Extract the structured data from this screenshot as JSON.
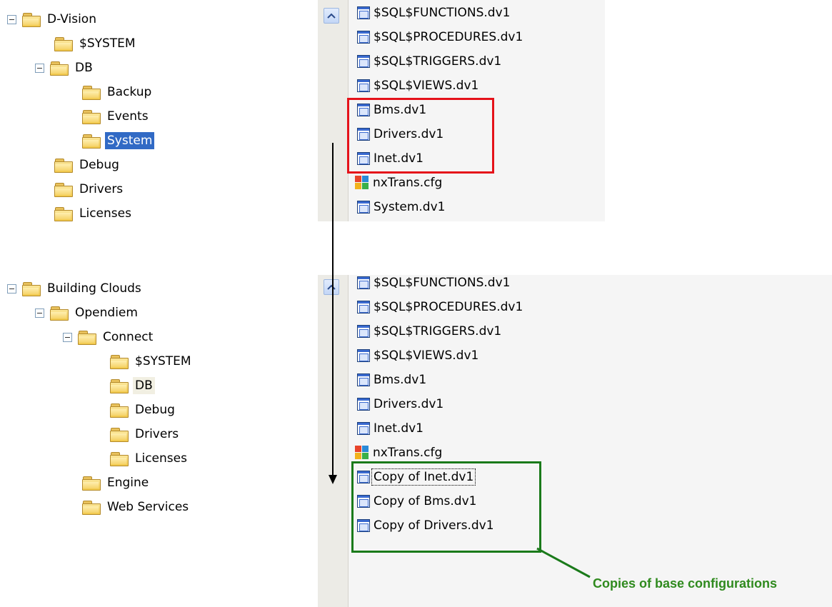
{
  "tree_top": {
    "root": "D-Vision",
    "children": [
      "$SYSTEM",
      "DB",
      "Backup",
      "Events",
      "System",
      "Debug",
      "Drivers",
      "Licenses"
    ]
  },
  "tree_bottom": {
    "root": "Building Clouds",
    "items": [
      "Opendiem",
      "Connect",
      "$SYSTEM",
      "DB",
      "Debug",
      "Drivers",
      "Licenses",
      "Engine",
      "Web Services"
    ]
  },
  "files_top": [
    "$SQL$FUNCTIONS.dv1",
    "$SQL$PROCEDURES.dv1",
    "$SQL$TRIGGERS.dv1",
    "$SQL$VIEWS.dv1",
    "Bms.dv1",
    "Drivers.dv1",
    "Inet.dv1",
    "nxTrans.cfg",
    "System.dv1"
  ],
  "files_bottom": [
    "$SQL$FUNCTIONS.dv1",
    "$SQL$PROCEDURES.dv1",
    "$SQL$TRIGGERS.dv1",
    "$SQL$VIEWS.dv1",
    "Bms.dv1",
    "Drivers.dv1",
    "Inet.dv1",
    "nxTrans.cfg",
    "Copy of Inet.dv1",
    "Copy of Bms.dv1",
    "Copy of Drivers.dv1"
  ],
  "annotation": "Copies of base configurations",
  "colors": {
    "highlight_box": "#e5121a",
    "copies_box": "#1a7a1a",
    "annotation_text": "#2f8a1e",
    "selection": "#316ac5"
  }
}
